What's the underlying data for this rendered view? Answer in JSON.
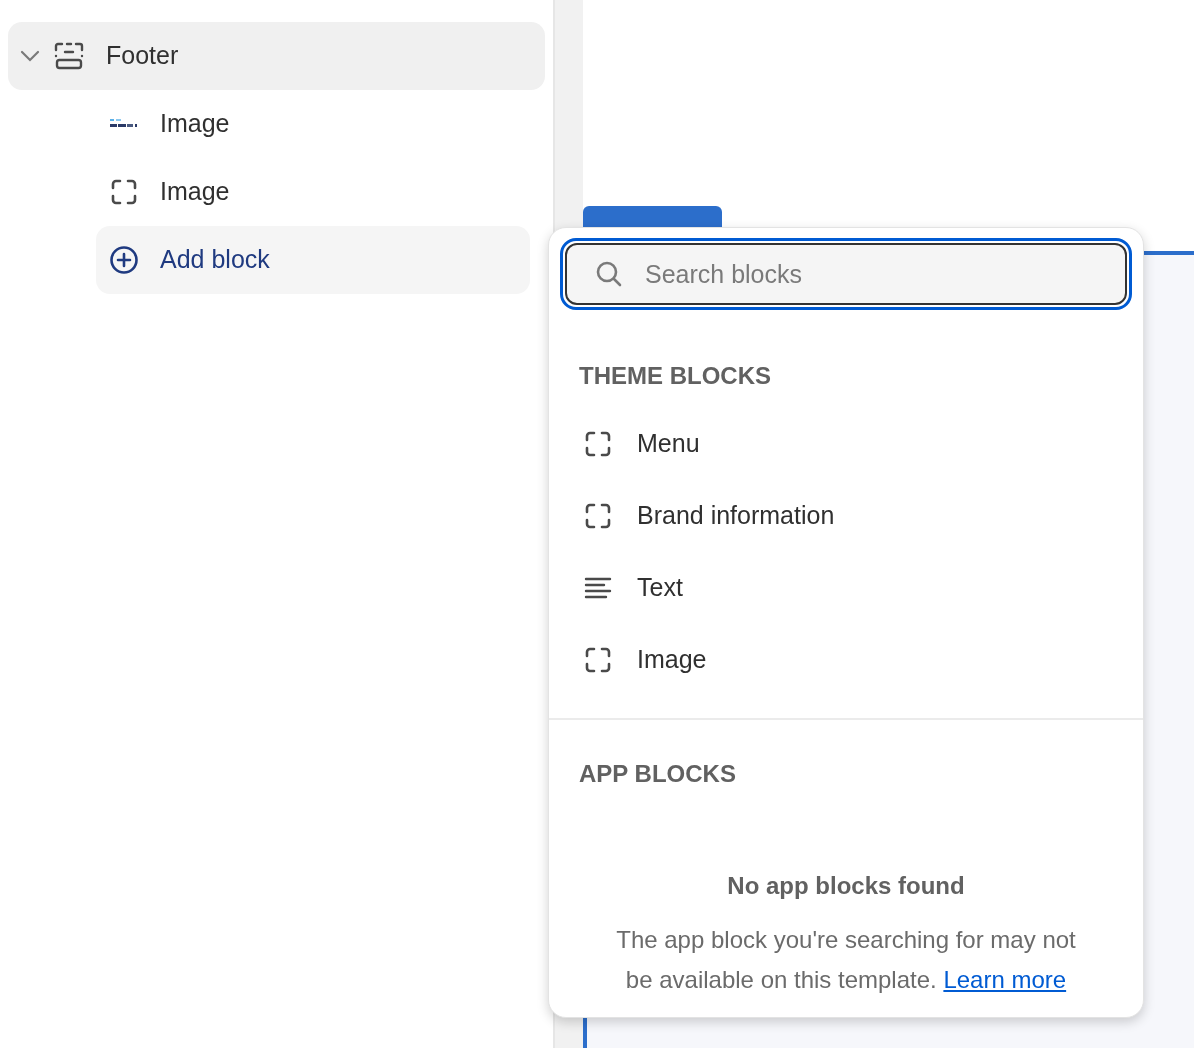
{
  "tree": {
    "label": "Footer",
    "expanded": true,
    "selected": true,
    "children": [
      {
        "label": "Image",
        "kind": "thumbnail",
        "selected": false
      },
      {
        "label": "Image",
        "kind": "block",
        "selected": false
      }
    ],
    "add_button": {
      "label": "Add block"
    }
  },
  "popover": {
    "search": {
      "placeholder": "Search blocks"
    },
    "sections": [
      {
        "title": "THEME BLOCKS",
        "items": [
          {
            "label": "Menu",
            "kind": "block"
          },
          {
            "label": "Brand information",
            "kind": "block"
          },
          {
            "label": "Text",
            "kind": "text"
          },
          {
            "label": "Image",
            "kind": "block"
          }
        ]
      },
      {
        "title": "APP BLOCKS",
        "empty_title": "No app blocks found",
        "empty_text": "The app block you're searching for may not be available on this template.",
        "link": "Learn more"
      }
    ]
  }
}
